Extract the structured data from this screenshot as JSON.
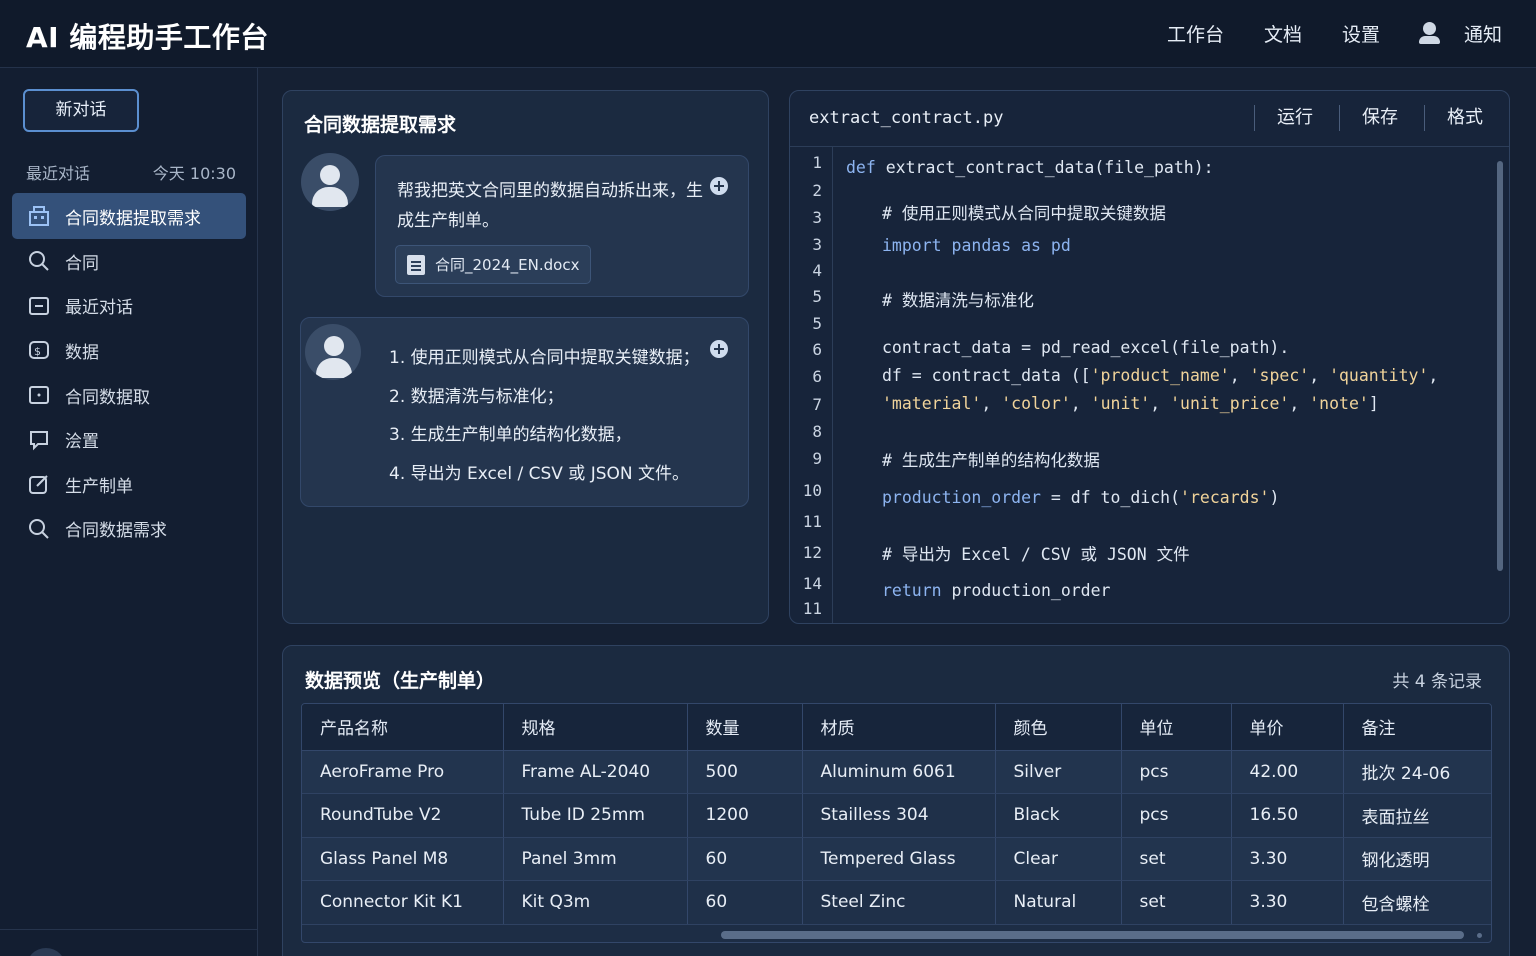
{
  "header": {
    "app_title": "AI 编程助手工作台",
    "nav": [
      "工作台",
      "文档",
      "设置",
      "通知"
    ]
  },
  "sidebar": {
    "new_chat_label": "新对话",
    "recent_label": "最近对话",
    "recent_time": "今天 10:30",
    "items": [
      {
        "label": "合同数据提取需求",
        "icon": "building-icon",
        "active": true
      },
      {
        "label": "合同",
        "icon": "search-icon",
        "active": false
      },
      {
        "label": "最近对话",
        "icon": "minus-square-icon",
        "active": false
      },
      {
        "label": "数据",
        "icon": "data-icon",
        "active": false
      },
      {
        "label": "合同数据取",
        "icon": "square-dot-icon",
        "active": false
      },
      {
        "label": "浍置",
        "icon": "comment-icon",
        "active": false
      },
      {
        "label": "生产制单",
        "icon": "edit-icon",
        "active": false
      },
      {
        "label": "合同数据需求",
        "icon": "search-icon",
        "active": false
      }
    ]
  },
  "chat": {
    "title": "合同数据提取需求",
    "user_message": "帮我把英文合同里的数据自动拆出来，生成生产制单。",
    "attachment": "合同_2024_EN.docx",
    "assistant_steps": [
      "1. 使用正则模式从合同中提取关键数据；",
      "2. 数据清洗与标准化；",
      "3. 生成生产制单的结构化数据，",
      "4. 导出为 Excel / CSV 或 JSON 文件。"
    ]
  },
  "editor": {
    "filename": "extract_contract.py",
    "actions": [
      "运行",
      "保存",
      "格式"
    ],
    "line_numbers": [
      "1",
      "2",
      "3",
      "3",
      "4",
      "5",
      "5",
      "6",
      "6",
      "7",
      "8",
      "9",
      "10",
      "11",
      "12",
      "14",
      "11"
    ],
    "lines": {
      "l1_kw": "def",
      "l1_rest": " extract_contract_data(file_path):",
      "l2": "# 使用正则模式从合同中提取关键数据",
      "l3_kw": "import",
      "l3_rest": " pandas ",
      "l3_kw2": "as",
      "l3_rest2": " pd",
      "l4": "# 数据清洗与标准化",
      "l5": "contract_data = pd_read_excel(file_path).",
      "l6_a": "df = contract_data ([",
      "l6_s1": "'product_name'",
      "l6_c1": ", ",
      "l6_s2": "'spec'",
      "l6_c2": ", ",
      "l6_s3": "'quantity'",
      "l6_c3": ",",
      "l7_s1": "'material'",
      "l7_c1": ", ",
      "l7_s2": "'color'",
      "l7_c2": ", ",
      "l7_s3": "'unit'",
      "l7_c3": ", ",
      "l7_s4": "'unit_price'",
      "l7_c4": ", ",
      "l7_s5": "'note'",
      "l7_c5": "]",
      "l8": "# 生成生产制单的结构化数据",
      "l9_kw": "production_order",
      "l9_a": " = df to_dich(",
      "l9_s": "'recards'",
      "l9_b": ")",
      "l10": "# 导出为 Excel / CSV 或 JSON 文件",
      "l11_kw": "return",
      "l11_rest": " production_order"
    }
  },
  "table": {
    "title": "数据预览（生产制单）",
    "count": "共 4 条记录",
    "columns": [
      "产品名称",
      "规格",
      "数量",
      "材质",
      "颜色",
      "单位",
      "单价",
      "备注"
    ],
    "rows": [
      [
        "AeroFrame Pro",
        "Frame AL-2040",
        "500",
        "Aluminum 6061",
        "Silver",
        "pcs",
        "42.00",
        "批次 24-06"
      ],
      [
        "RoundTube V2",
        "Tube ID 25mm",
        "1200",
        "Stailless 304",
        "Black",
        "pcs",
        "16.50",
        "表面拉丝"
      ],
      [
        "Glass Panel M8",
        "Panel 3mm",
        "60",
        "Tempered Glass",
        "Clear",
        "set",
        "3.30",
        "钢化透明"
      ],
      [
        "Connector Kit K1",
        "Kit Q3m",
        "60",
        "Steel Zinc",
        "Natural",
        "set",
        "3.30",
        "包含螺栓"
      ]
    ]
  }
}
